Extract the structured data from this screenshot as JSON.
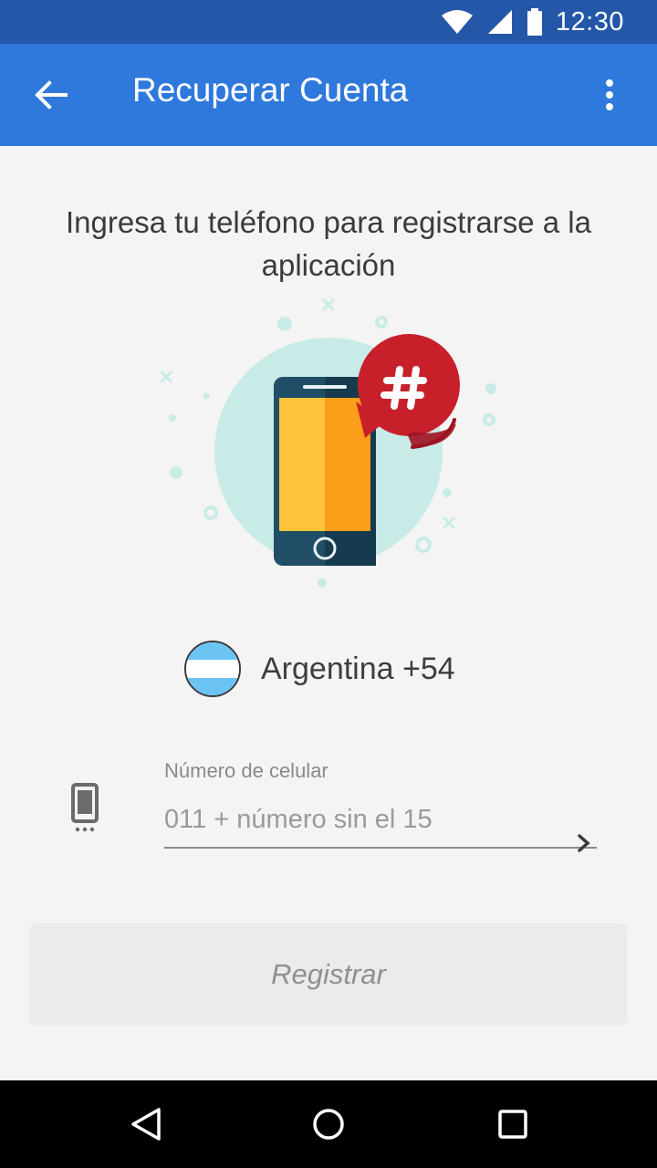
{
  "status_bar": {
    "time": "12:30",
    "icons": [
      "wifi-icon",
      "signal-icon",
      "battery-icon"
    ]
  },
  "app_bar": {
    "title": "Recuperar Cuenta",
    "back_icon": "arrow-back-icon",
    "menu_icon": "more-vert-icon",
    "color": "#2f78dc"
  },
  "main": {
    "heading": "Ingresa tu teléfono para registrarse a la aplicación",
    "illustration_icon": "phone-hash-illustration",
    "country": {
      "label": "Argentina +54",
      "flag_icon": "argentina-flag-icon"
    },
    "phone_field": {
      "label": "Número de celular",
      "placeholder": "011 + número sin el 15",
      "value": ""
    },
    "register_button": "Registrar"
  },
  "nav_bar": {
    "icons": [
      "back-triangle-icon",
      "home-circle-icon",
      "recents-square-icon"
    ]
  },
  "colors": {
    "status_bar": "#2457a8",
    "app_bar": "#2f78dc",
    "accent_red": "#c8202b",
    "flag_blue": "#6cc4f5"
  }
}
